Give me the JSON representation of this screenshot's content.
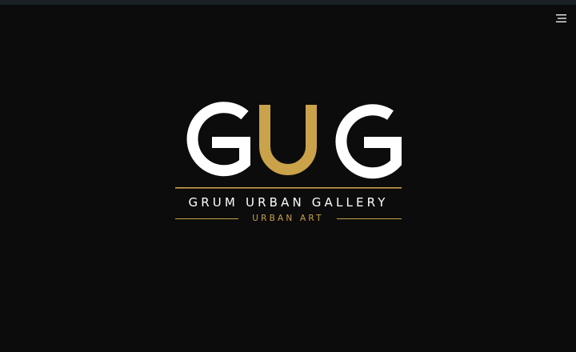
{
  "header": {
    "menu_icon": "hamburger-menu-icon"
  },
  "logo": {
    "monogram": [
      "G",
      "U",
      "G"
    ],
    "gallery_name": "GRUM URBAN GALLERY",
    "tagline": "URBAN ART"
  },
  "colors": {
    "background": "#0c0c0c",
    "top_strip": "#1a2024",
    "primary": "#ffffff",
    "accent": "#c9a24a"
  }
}
